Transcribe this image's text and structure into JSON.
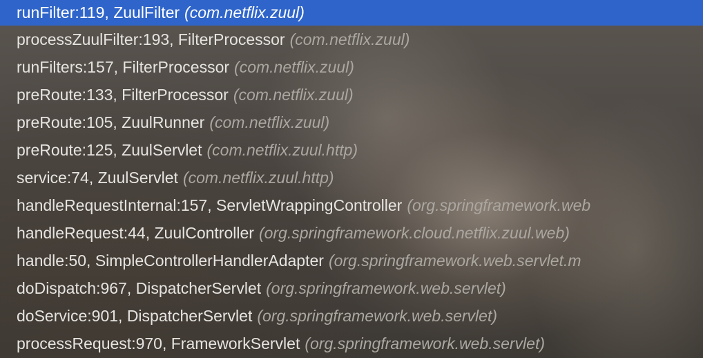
{
  "frames_panel": {
    "selected_index": 0,
    "colors": {
      "selection": "#2f65ca",
      "method_text": "#e6e4e0",
      "package_text": "#aba7a1"
    },
    "frames": [
      {
        "method": "runFilter:119, ZuulFilter",
        "package": "(com.netflix.zuul)"
      },
      {
        "method": "processZuulFilter:193, FilterProcessor",
        "package": "(com.netflix.zuul)"
      },
      {
        "method": "runFilters:157, FilterProcessor",
        "package": "(com.netflix.zuul)"
      },
      {
        "method": "preRoute:133, FilterProcessor",
        "package": "(com.netflix.zuul)"
      },
      {
        "method": "preRoute:105, ZuulRunner",
        "package": "(com.netflix.zuul)"
      },
      {
        "method": "preRoute:125, ZuulServlet",
        "package": "(com.netflix.zuul.http)"
      },
      {
        "method": "service:74, ZuulServlet",
        "package": "(com.netflix.zuul.http)"
      },
      {
        "method": "handleRequestInternal:157, ServletWrappingController",
        "package": "(org.springframework.web"
      },
      {
        "method": "handleRequest:44, ZuulController",
        "package": "(org.springframework.cloud.netflix.zuul.web)"
      },
      {
        "method": "handle:50, SimpleControllerHandlerAdapter",
        "package": "(org.springframework.web.servlet.m"
      },
      {
        "method": "doDispatch:967, DispatcherServlet",
        "package": "(org.springframework.web.servlet)"
      },
      {
        "method": "doService:901, DispatcherServlet",
        "package": "(org.springframework.web.servlet)"
      },
      {
        "method": "processRequest:970, FrameworkServlet",
        "package": "(org.springframework.web.servlet)"
      }
    ]
  }
}
